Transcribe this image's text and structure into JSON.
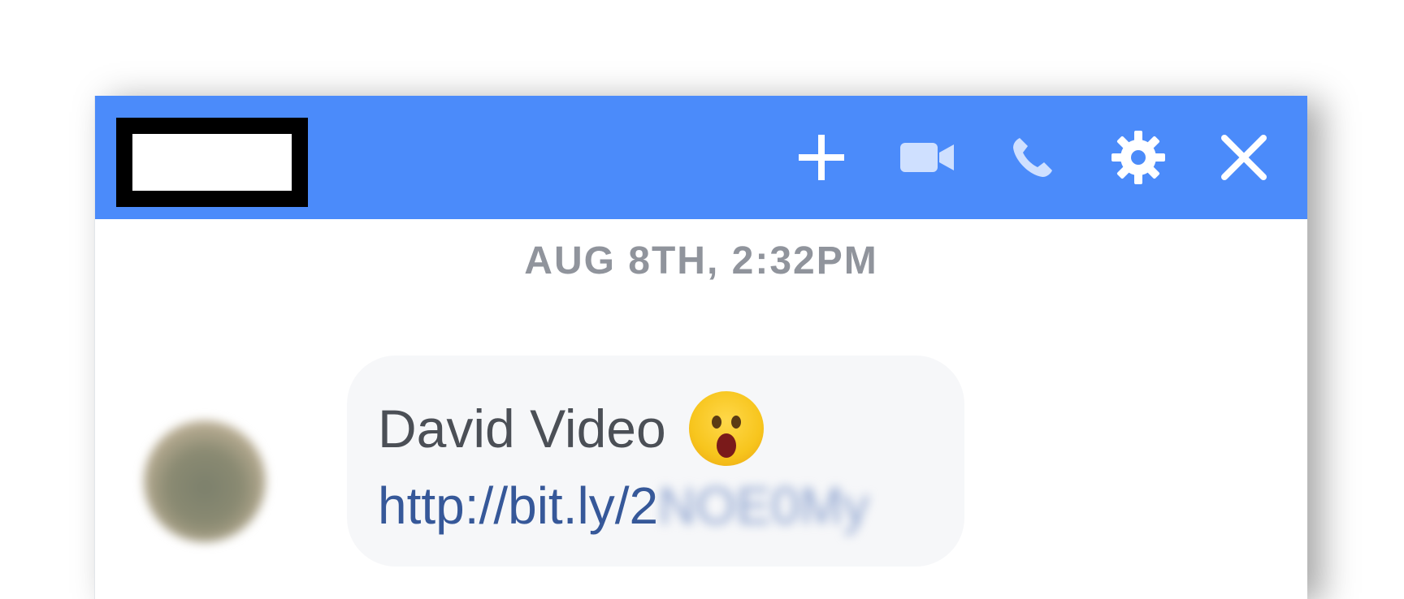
{
  "header": {
    "actions": [
      {
        "icon": "plus-icon",
        "color": "#ffffff"
      },
      {
        "icon": "video-camera-icon",
        "color": "#cfe0ff"
      },
      {
        "icon": "phone-icon",
        "color": "#cfe0ff"
      },
      {
        "icon": "gear-icon",
        "color": "#ffffff"
      },
      {
        "icon": "close-icon",
        "color": "#ffffff"
      }
    ],
    "background": "#4b8bfa"
  },
  "conversation": {
    "timestamp": "AUG 8TH, 2:32PM",
    "messages": [
      {
        "text": "David Video",
        "emoji": "wow-face-emoji",
        "link_visible": "http://bit.ly/2",
        "link_blurred": "NOE0My"
      }
    ]
  }
}
